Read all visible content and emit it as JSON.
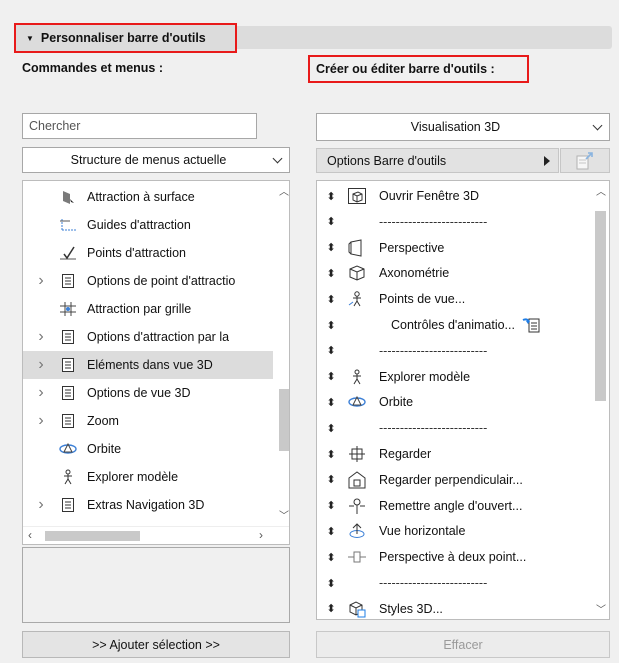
{
  "section": {
    "title": "Personnaliser barre d'outils"
  },
  "left": {
    "label": "Commandes et menus :",
    "search_placeholder": "Chercher",
    "menu_select": "Structure de menus actuelle",
    "items": [
      {
        "label": "Attraction à surface",
        "expandable": false,
        "icon": "surface-snap-icon"
      },
      {
        "label": "Guides d'attraction",
        "expandable": false,
        "icon": "snap-guides-icon"
      },
      {
        "label": "Points d'attraction",
        "expandable": false,
        "icon": "snap-points-icon"
      },
      {
        "label": "Options de point d'attractio",
        "expandable": true,
        "icon": "menu-list-icon"
      },
      {
        "label": "Attraction par grille",
        "expandable": false,
        "icon": "grid-snap-icon"
      },
      {
        "label": "Options d'attraction par la",
        "expandable": true,
        "icon": "menu-list-icon"
      },
      {
        "label": "Eléments dans vue 3D",
        "expandable": true,
        "icon": "menu-list-icon",
        "selected": true
      },
      {
        "label": "Options de vue 3D",
        "expandable": true,
        "icon": "menu-list-icon"
      },
      {
        "label": "Zoom",
        "expandable": true,
        "icon": "menu-list-icon"
      },
      {
        "label": "Orbite",
        "expandable": false,
        "icon": "orbit-icon"
      },
      {
        "label": "Explorer modèle",
        "expandable": false,
        "icon": "explore-model-icon"
      },
      {
        "label": "Extras Navigation 3D",
        "expandable": true,
        "icon": "menu-list-icon"
      }
    ],
    "add_button": ">> Ajouter sélection >>"
  },
  "right": {
    "label": "Créer ou éditer barre d'outils :",
    "toolbar_select": "Visualisation 3D",
    "options_label": "Options Barre d'outils",
    "items": [
      {
        "label": "Ouvrir Fenêtre 3D",
        "kind": "item",
        "icon": "open-3d-window-icon"
      },
      {
        "label": "--------------------------",
        "kind": "sep"
      },
      {
        "label": "Perspective",
        "kind": "item",
        "icon": "perspective-icon"
      },
      {
        "label": "Axonométrie",
        "kind": "item",
        "icon": "axonometry-icon"
      },
      {
        "label": "Points de vue...",
        "kind": "item",
        "icon": "viewpoints-icon"
      },
      {
        "label": "Contrôles d'animatio...",
        "kind": "sub",
        "icon": "submenu-icon"
      },
      {
        "label": "--------------------------",
        "kind": "sep"
      },
      {
        "label": "Explorer modèle",
        "kind": "item",
        "icon": "explore-model-icon"
      },
      {
        "label": "Orbite",
        "kind": "item",
        "icon": "orbit-icon"
      },
      {
        "label": "--------------------------",
        "kind": "sep"
      },
      {
        "label": "Regarder",
        "kind": "item",
        "icon": "look-to-icon"
      },
      {
        "label": "Regarder perpendiculair...",
        "kind": "item",
        "icon": "look-perpendicular-icon"
      },
      {
        "label": "Remettre angle d'ouvert...",
        "kind": "item",
        "icon": "reset-view-cone-icon"
      },
      {
        "label": "Vue horizontale",
        "kind": "item",
        "icon": "horizontal-view-icon"
      },
      {
        "label": "Perspective à deux point...",
        "kind": "item",
        "icon": "two-point-perspective-icon"
      },
      {
        "label": "--------------------------",
        "kind": "sep"
      },
      {
        "label": "Styles 3D...",
        "kind": "item",
        "icon": "3d-styles-icon"
      }
    ],
    "clear_button": "Effacer"
  },
  "colors": {
    "highlight_border": "#e81a1a",
    "selected_row": "#dcdcdc"
  }
}
